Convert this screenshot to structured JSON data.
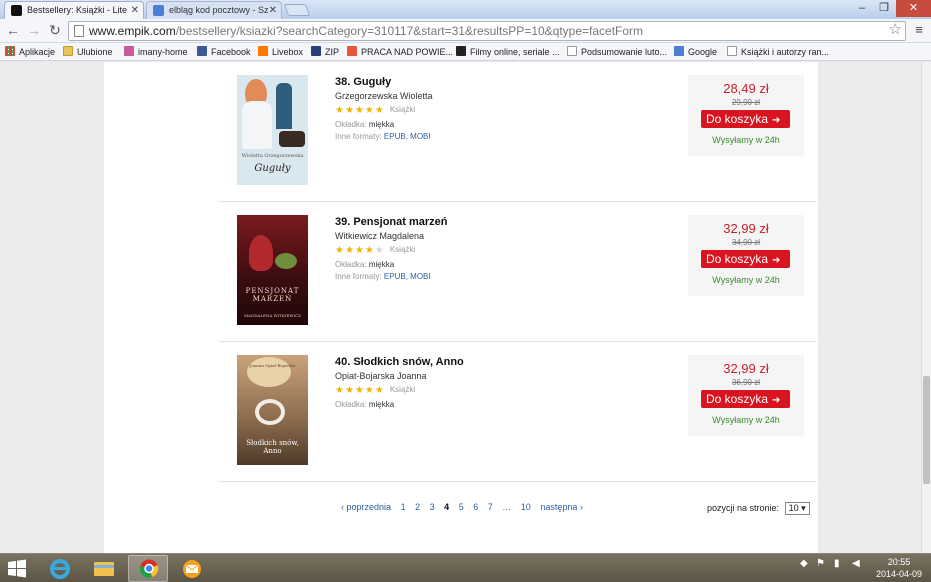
{
  "browser": {
    "tabs": [
      {
        "title": "Bestsellery: Książki - Litera",
        "active": true
      },
      {
        "title": "elbląg kod pocztowy - Szu",
        "active": false
      }
    ],
    "url_host": "www.empik.com",
    "url_path": "/bestsellery/ksiazki?searchCategory=310117&start=31&resultsPP=10&qtype=facetForm",
    "bookmarks": [
      {
        "label": "Aplikacje",
        "icon": "apps-grid-icon"
      },
      {
        "label": "Ulubione",
        "icon": "folder-icon"
      },
      {
        "label": "imany-home",
        "icon": "site-icon"
      },
      {
        "label": "Facebook",
        "icon": "facebook-icon"
      },
      {
        "label": "Livebox",
        "icon": "livebox-icon"
      },
      {
        "label": "ZIP",
        "icon": "nfz-icon"
      },
      {
        "label": "PRACA NAD POWIE...",
        "icon": "site-icon"
      },
      {
        "label": "Filmy online, seriale ...",
        "icon": "site-icon"
      },
      {
        "label": "Podsumowanie luto...",
        "icon": "page-icon"
      },
      {
        "label": "Google",
        "icon": "google-icon"
      },
      {
        "label": "Książki i autorzy ran...",
        "icon": "page-icon"
      }
    ]
  },
  "products": [
    {
      "title": "38. Guguły",
      "author": "Grzegorzewska Wioletta",
      "rating": 5,
      "category": "Książki",
      "cover_label": "Okładka:",
      "cover_type": "miękka",
      "formats_label": "Inne formaty:",
      "formats": "EPUB, MOBI",
      "price": "28,49 zł",
      "old_price": "29,90 zł",
      "cart_label": "Do koszyka",
      "shipping": "Wysyłamy w 24h",
      "cover_author": "Wioletta Grzegorzewska",
      "cover_title": "Guguły",
      "cover_color": "#d9e7ee"
    },
    {
      "title": "39. Pensjonat marzeń",
      "author": "Witkiewicz Magdalena",
      "rating": 4,
      "category": "Książki",
      "cover_label": "Okładka:",
      "cover_type": "miękka",
      "formats_label": "Inne formaty:",
      "formats": "EPUB, MOBI",
      "price": "32,99 zł",
      "old_price": "34,90 zł",
      "cart_label": "Do koszyka",
      "shipping": "Wysyłamy w 24h",
      "cover_author": "MAGDALENA WITKIEWICZ",
      "cover_title": "PENSJONAT MARZEŃ",
      "cover_color": "#5a1418"
    },
    {
      "title": "40. Słodkich snów, Anno",
      "author": "Opiat-Bojarska Joanna",
      "rating": 5,
      "category": "Książki",
      "cover_label": "Okładka:",
      "cover_type": "miękka",
      "formats_label": "",
      "formats": "",
      "price": "32,99 zł",
      "old_price": "36,90 zł",
      "cart_label": "Do koszyka",
      "shipping": "Wysyłamy w 24h",
      "cover_author": "Joanna Opiat-Bojarska",
      "cover_title": "Słodkich snów, Anno",
      "cover_color": "#8a6a4c"
    }
  ],
  "pagination": {
    "prev": "‹ poprzednia",
    "pages": [
      "1",
      "2",
      "3",
      "4",
      "5",
      "6",
      "7",
      "…",
      "10"
    ],
    "current": "4",
    "next": "następna ›",
    "per_page_label": "pozycji na stronie:",
    "per_page_value": "10 ▾"
  },
  "taskbar": {
    "time": "20:55",
    "date": "2014-04-09"
  },
  "colors": {
    "brand_red": "#d7141f",
    "price_red": "#c81e2b",
    "shipping_green": "#3a8a2e",
    "link_blue": "#2b5fa3",
    "star_gold": "#f0b400"
  }
}
